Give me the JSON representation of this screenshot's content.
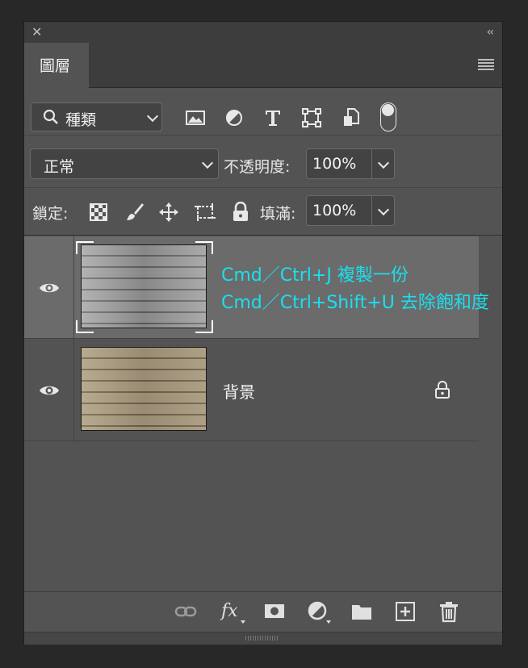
{
  "panel": {
    "close_glyph": "✕",
    "collapse_glyph": "‹‹",
    "tab_label": "圖層",
    "menu_icon": "hamburger-menu-icon"
  },
  "filter": {
    "kind_label": "種類",
    "icons": [
      "image-filter-icon",
      "adjustment-filter-icon",
      "type-filter-icon",
      "shape-filter-icon",
      "smart-object-filter-icon"
    ],
    "filter_toggle": "on"
  },
  "blending": {
    "mode": "正常",
    "opacity_label": "不透明度:",
    "opacity_value": "100%"
  },
  "lock": {
    "label": "鎖定:",
    "fill_label": "填滿:",
    "fill_value": "100%",
    "icons": [
      "lock-transparent-pixels-icon",
      "lock-image-pixels-icon",
      "lock-position-icon",
      "lock-artboard-icon",
      "lock-all-icon"
    ]
  },
  "layers": [
    {
      "name": "",
      "selected": true,
      "visible": true,
      "annotation_line1": "Cmd／Ctrl+J 複製一份",
      "annotation_line2": "Cmd／Ctrl+Shift+U 去除飽和度",
      "thumbnail_tone": "grayscale wood"
    },
    {
      "name": "背景",
      "selected": false,
      "visible": true,
      "locked": true,
      "thumbnail_tone": "tan wood"
    }
  ],
  "bottom_icons": [
    "link-layers-icon",
    "fx-icon",
    "add-mask-icon",
    "adjustment-layer-icon",
    "new-group-icon",
    "new-layer-icon",
    "delete-layer-icon"
  ],
  "colors": {
    "panel_bg": "#535353",
    "selected_layer": "#6b6b6b",
    "annotation": "#19e0f0"
  }
}
